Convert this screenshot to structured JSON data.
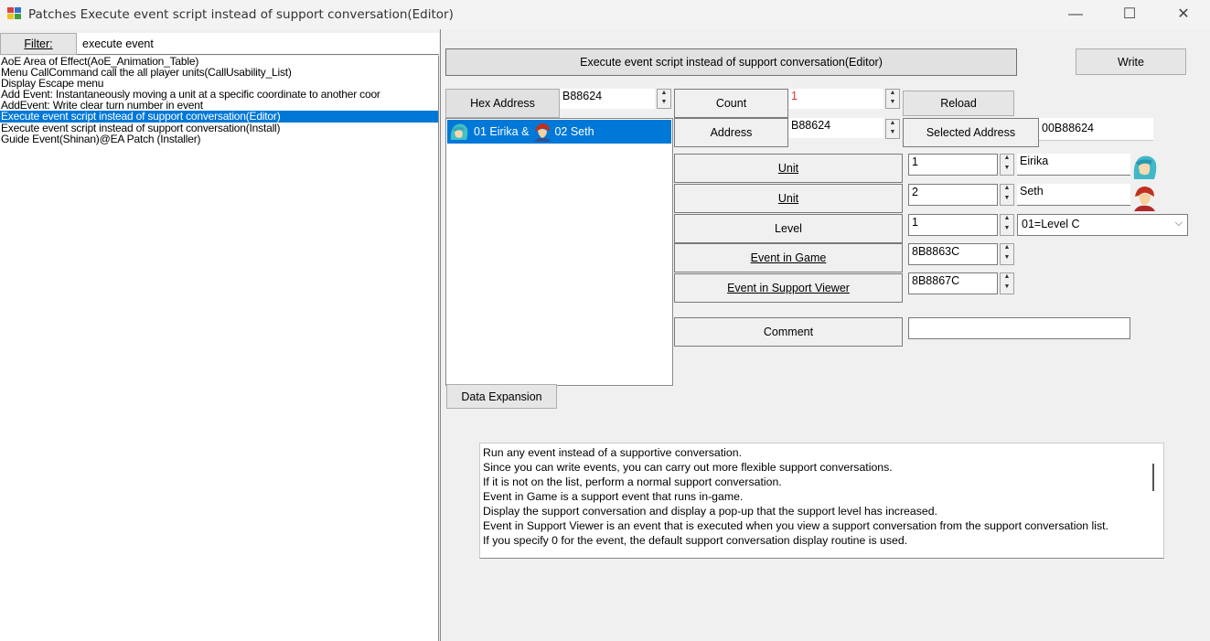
{
  "window": {
    "title": "Patches Execute event script instead of support conversation(Editor)",
    "minimize": "—",
    "maximize": "☐",
    "close": "✕"
  },
  "filter": {
    "label": "Filter:",
    "value": "execute event"
  },
  "patch_list": [
    "AoE Area of Effect(AoE_Animation_Table)",
    "Menu CallCommand  call the all player units(CallUsability_List)",
    "Display Escape menu",
    "Add Event: Instantaneously moving a unit at a specific coordinate to another coor",
    "AddEvent: Write clear turn number in event",
    "Execute event script instead of support conversation(Editor)",
    "Execute event script instead of support conversation(Install)",
    "Guide Event(Shinan)@EA Patch (Installer)"
  ],
  "selected_patch_index": 5,
  "editor": {
    "header_button": "Execute event script instead of support conversation(Editor)",
    "write_button": "Write",
    "hex_address_label": "Hex Address",
    "hex_address_value": "B88624",
    "count_label": "Count",
    "count_value": "1",
    "reload_button": "Reload",
    "address_label": "Address",
    "address_value": "B88624",
    "selected_address_label": "Selected Address",
    "selected_address_value": "00B88624",
    "support_list_item": {
      "text1": "01 Eirika &",
      "text2": "02 Seth"
    },
    "unit1_label": "Unit",
    "unit1_value": "1",
    "unit1_name": "Eirika",
    "unit2_label": "Unit",
    "unit2_value": "2",
    "unit2_name": "Seth",
    "level_label": "Level",
    "level_value": "1",
    "level_select": "01=Level C",
    "event_in_game_label": "Event in Game",
    "event_in_game_value": "8B8863C",
    "event_support_viewer_label": "Event in Support Viewer",
    "event_support_viewer_value": "8B8867C",
    "comment_label": "Comment",
    "comment_value": "",
    "data_expansion_button": "Data Expansion"
  },
  "description": [
    "Run any event instead of a supportive conversation.",
    "Since you can write events, you can carry out more flexible support conversations.",
    "If it is not on the list, perform a normal support conversation.",
    "Event in Game is a support event that runs in-game.",
    "Display the support conversation and display a pop-up that the support level has increased.",
    "Event in Support Viewer is an event that is executed when you view a support conversation from the support conversation list.",
    "If you specify 0 for the event, the default support conversation display routine is used."
  ],
  "colors": {
    "selection": "#0078d7",
    "count_text": "#e03030"
  }
}
